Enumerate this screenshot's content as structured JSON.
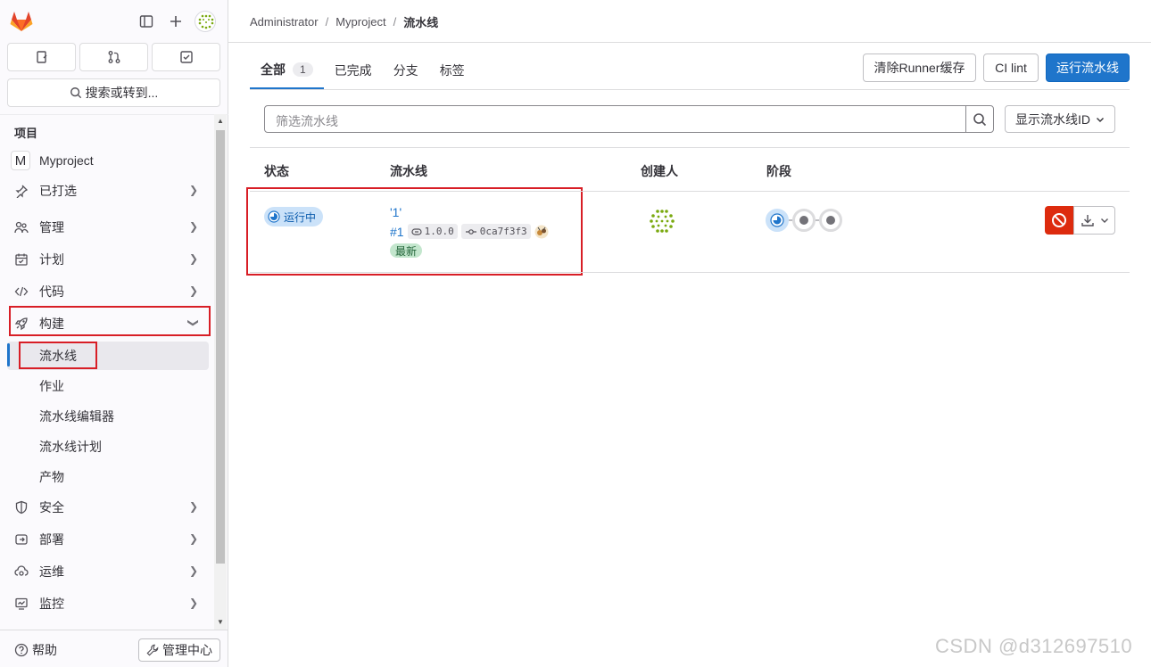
{
  "breadcrumb": {
    "items": [
      "Administrator",
      "Myproject",
      "流水线"
    ],
    "separator": "/"
  },
  "sidebar": {
    "search_label": "搜索或转到...",
    "section_title": "项目",
    "project_initial": "M",
    "project_name": "Myproject",
    "items": [
      {
        "label": "已打选",
        "icon": "pin-icon"
      },
      {
        "label": "管理",
        "icon": "users-icon"
      },
      {
        "label": "计划",
        "icon": "calendar-icon"
      },
      {
        "label": "代码",
        "icon": "code-icon"
      },
      {
        "label": "构建",
        "icon": "rocket-icon"
      },
      {
        "label": "安全",
        "icon": "shield-icon"
      },
      {
        "label": "部署",
        "icon": "deploy-icon"
      },
      {
        "label": "运维",
        "icon": "cloud-gear-icon"
      },
      {
        "label": "监控",
        "icon": "monitor-icon"
      }
    ],
    "build_sub": [
      "流水线",
      "作业",
      "流水线编辑器",
      "流水线计划",
      "产物"
    ],
    "help_label": "帮助",
    "admin_label": "管理中心"
  },
  "tabs": [
    {
      "label": "全部",
      "count": "1"
    },
    {
      "label": "已完成"
    },
    {
      "label": "分支"
    },
    {
      "label": "标签"
    }
  ],
  "actions": {
    "clear_cache": "清除Runner缓存",
    "ci_lint": "CI lint",
    "run_pipeline": "运行流水线"
  },
  "filter": {
    "placeholder": "筛选流水线",
    "display_dropdown": "显示流水线ID"
  },
  "table": {
    "headers": [
      "状态",
      "流水线",
      "创建人",
      "阶段"
    ],
    "rows": [
      {
        "status": "运行中",
        "name": "'1'",
        "id": "#1",
        "ref": "1.0.0",
        "commit": "0ca7f3f3",
        "badge": "最新"
      }
    ]
  },
  "watermark": "CSDN @d312697510",
  "colors": {
    "primary": "#1f75cb",
    "danger": "#dd2b0e",
    "highlight": "#d81e26"
  }
}
